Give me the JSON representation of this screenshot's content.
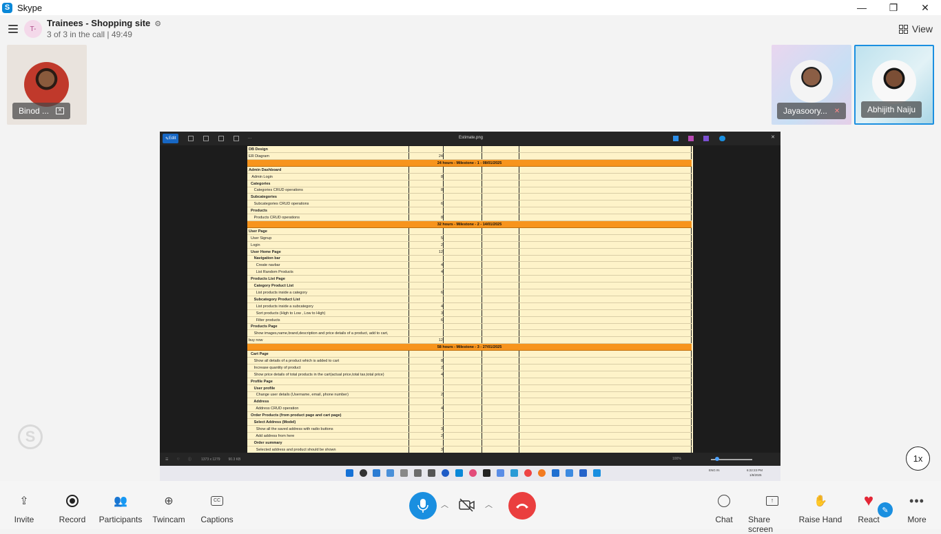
{
  "window": {
    "app_name": "Skype",
    "minimize": "—",
    "restore": "❐",
    "close": "✕"
  },
  "call": {
    "avatar_initials": "T-",
    "title": "Trainees - Shopping site",
    "subtitle": "3 of 3 in the call | 49:49",
    "view_label": "View"
  },
  "participants": [
    {
      "name": "Binod ...",
      "bg": "#e9e3dd"
    },
    {
      "name": "Jayasoory...",
      "muted": true
    },
    {
      "name": "Abhijith Naiju",
      "active_speaker": true
    }
  ],
  "shared_screen": {
    "edit_label": "Edit",
    "filename": "Estimate.png",
    "status_dims": "1373 x 1279",
    "status_size": "90.3 KB",
    "zoom": "100%",
    "clock_time": "6:22:23 PM",
    "clock_date": "1/8/2025",
    "lang": "ENG IN",
    "rows": [
      {
        "t": "n",
        "label": "DB Design",
        "num": "",
        "bold": true
      },
      {
        "t": "n",
        "label": "ER Diagram",
        "num": "24"
      },
      {
        "t": "m",
        "label": "24 hours - Milestone - 1 - 08/01/2025"
      },
      {
        "t": "n",
        "label": "Admin Dashboard",
        "num": "",
        "bold": true
      },
      {
        "t": "n",
        "label": "   Admin Login",
        "num": "8"
      },
      {
        "t": "n",
        "label": "  Categories",
        "num": "",
        "bold": true
      },
      {
        "t": "n",
        "label": "     Categories CRUD operations",
        "num": "8"
      },
      {
        "t": "n",
        "label": "  Subcategories",
        "num": "",
        "bold": true
      },
      {
        "t": "n",
        "label": "     Subcategories CRUD operations",
        "num": "6"
      },
      {
        "t": "n",
        "label": "  Products",
        "num": "",
        "bold": true
      },
      {
        "t": "n",
        "label": "     Products CRUD operations",
        "num": "8"
      },
      {
        "t": "m",
        "label": "32 hours - Milestone - 2 - 14/01/2025"
      },
      {
        "t": "n",
        "label": "User Page",
        "num": "",
        "bold": true
      },
      {
        "t": "n",
        "label": "  User Signup",
        "num": "5"
      },
      {
        "t": "n",
        "label": "  Login",
        "num": "2"
      },
      {
        "t": "n",
        "label": "  User Home Page",
        "num": "12",
        "bold": true
      },
      {
        "t": "n",
        "label": "     Navigation bar",
        "num": "",
        "bold": true
      },
      {
        "t": "n",
        "label": "       Create navbar",
        "num": "4"
      },
      {
        "t": "n",
        "label": "       List Random Products",
        "num": "4"
      },
      {
        "t": "n",
        "label": "  Products List Page",
        "num": "",
        "bold": true
      },
      {
        "t": "n",
        "label": "     Category Product List",
        "num": "",
        "bold": true
      },
      {
        "t": "n",
        "label": "       List products inside a category",
        "num": "6"
      },
      {
        "t": "n",
        "label": "     Subcategory Product List",
        "num": "",
        "bold": true
      },
      {
        "t": "n",
        "label": "       List products inside a subcategory",
        "num": "4"
      },
      {
        "t": "n",
        "label": "       Sort products (High to Low , Low to High)",
        "num": "3"
      },
      {
        "t": "n",
        "label": "       Filter products",
        "num": "6"
      },
      {
        "t": "n",
        "label": "  Products Page",
        "num": "",
        "bold": true
      },
      {
        "t": "n",
        "label": "     Show images,name,brand,description and price details of a product, add to cart,",
        "num": ""
      },
      {
        "t": "n",
        "label": "buy now",
        "num": "12"
      },
      {
        "t": "m",
        "label": "58 hours - Milestone - 3 - 27/01/2025"
      },
      {
        "t": "n",
        "label": "  Cart Page",
        "num": "",
        "bold": true
      },
      {
        "t": "n",
        "label": "     Show all details of a product which is added to cart",
        "num": "8"
      },
      {
        "t": "n",
        "label": "     Increase quantity of product",
        "num": "2"
      },
      {
        "t": "n",
        "label": "     Show price details of total products in the cart(actual price,total tax,total price)",
        "num": "4"
      },
      {
        "t": "n",
        "label": "  Profile Page",
        "num": "",
        "bold": true
      },
      {
        "t": "n",
        "label": "     User profile",
        "num": "",
        "bold": true
      },
      {
        "t": "n",
        "label": "       Change user details (Username, email, phone number)",
        "num": "2"
      },
      {
        "t": "n",
        "label": "     Address",
        "num": "",
        "bold": true
      },
      {
        "t": "n",
        "label": "       Address CRUD operation",
        "num": "4"
      },
      {
        "t": "n",
        "label": "  Order Products (from product page and cart page)",
        "num": "",
        "bold": true
      },
      {
        "t": "n",
        "label": "     Select Address (Model)",
        "num": "",
        "bold": true
      },
      {
        "t": "n",
        "label": "       Show all the saved address with radio buttons",
        "num": "3"
      },
      {
        "t": "n",
        "label": "       Add address from here",
        "num": "2"
      },
      {
        "t": "n",
        "label": "     Order summary",
        "num": "",
        "bold": true
      },
      {
        "t": "n",
        "label": "       Selected address and product should be shown",
        "num": "3"
      }
    ]
  },
  "speed_badge": "1x",
  "toolbar": {
    "invite": "Invite",
    "record": "Record",
    "participants": "Participants",
    "twincam": "Twincam",
    "captions": "Captions",
    "chat": "Chat",
    "share_screen": "Share screen",
    "raise_hand": "Raise Hand",
    "react": "React",
    "more": "More"
  },
  "colors": {
    "accent": "#1a8fe0",
    "end_call": "#ea3f3f",
    "milestone": "#f7941d",
    "sheet_bg": "#fef3c9"
  }
}
